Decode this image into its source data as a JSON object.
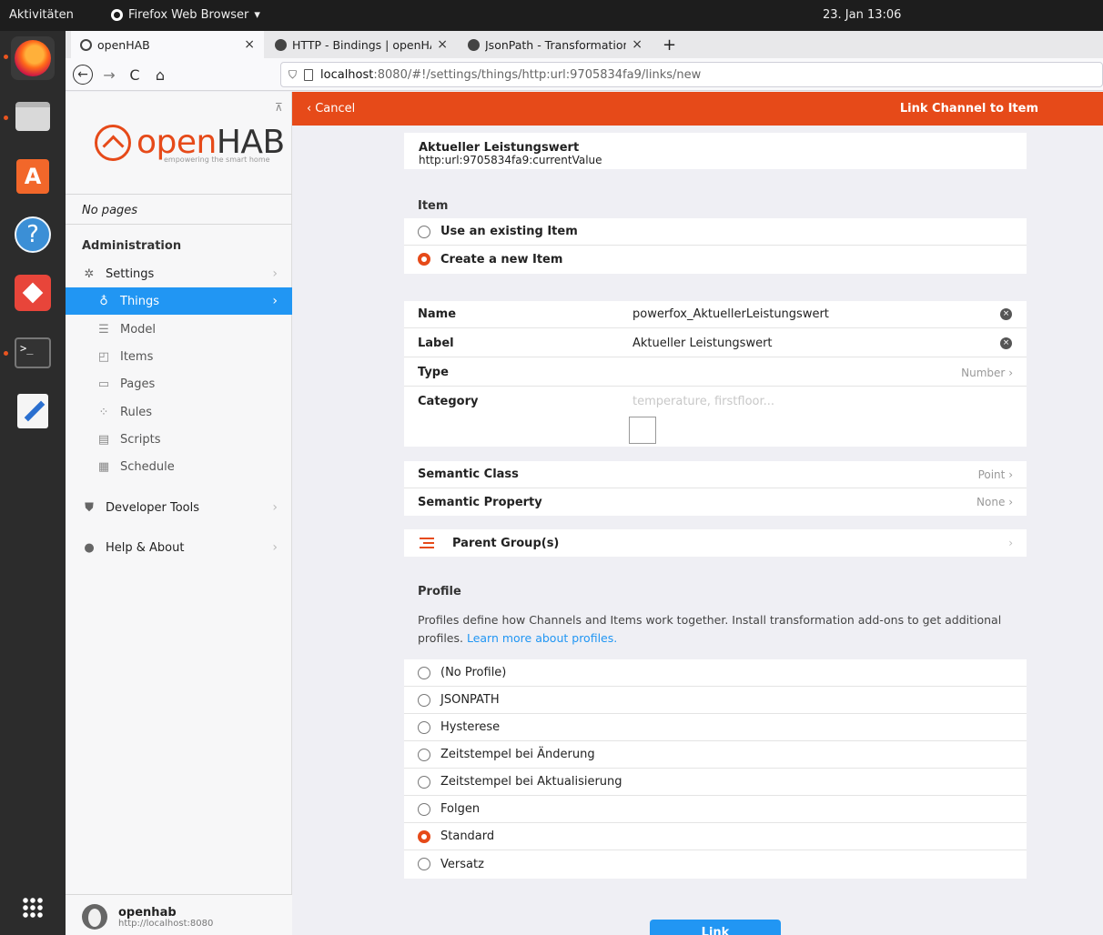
{
  "system": {
    "activities": "Aktivitäten",
    "app_menu": "Firefox Web Browser",
    "app_menu_arrow": "▾",
    "clock": "23. Jan  13:06"
  },
  "dock": {
    "items": [
      "firefox-icon",
      "files-icon",
      "software-icon",
      "help-icon",
      "anydesk-icon",
      "terminal-icon",
      "text-editor-icon",
      "app-grid-icon"
    ],
    "terminal_prompt": ">_"
  },
  "browser": {
    "tabs": [
      {
        "label": "openHAB",
        "close": "×"
      },
      {
        "label": "HTTP - Bindings | openHAB",
        "close": "×"
      },
      {
        "label": "JsonPath - Transformations",
        "close": "×"
      }
    ],
    "new_tab": "+",
    "nav": {
      "back": "←",
      "forward": "→",
      "reload": "C",
      "home": "⌂"
    },
    "url_host": "localhost",
    "url_path": ":8080/#!/settings/things/http:url:9705834fa9/links/new"
  },
  "sidebar": {
    "logo_text_1": "open",
    "logo_text_2": "HAB",
    "tagline": "empowering the smart home",
    "no_pages": "No pages",
    "admin_title": "Administration",
    "settings": "Settings",
    "sub_items": [
      "Things",
      "Model",
      "Items",
      "Pages",
      "Rules",
      "Scripts",
      "Schedule"
    ],
    "developer_tools": "Developer Tools",
    "help_about": "Help & About",
    "chevron": "›",
    "footer_user": "openhab",
    "footer_host": "http://localhost:8080"
  },
  "header": {
    "cancel": "Cancel",
    "cancel_chevron": "‹",
    "title": "Link Channel to Item"
  },
  "channel": {
    "title": "Aktueller Leistungswert",
    "uid": "http:url:9705834fa9:currentValue"
  },
  "item_section": {
    "title": "Item",
    "options": [
      "Use an existing Item",
      "Create a new Item"
    ],
    "selected": 1
  },
  "form": {
    "name_label": "Name",
    "name_value": "powerfox_AktuellerLeistungswert",
    "label_label": "Label",
    "label_value": "Aktueller Leistungswert",
    "type_label": "Type",
    "type_value": "Number",
    "category_label": "Category",
    "category_placeholder": "temperature, firstfloor...",
    "clear": "×",
    "chevron": "›"
  },
  "semantic": {
    "class_label": "Semantic Class",
    "class_value": "Point",
    "property_label": "Semantic Property",
    "property_value": "None"
  },
  "parent_groups": {
    "label": "Parent Group(s)"
  },
  "profile": {
    "title": "Profile",
    "description": "Profiles define how Channels and Items work together. Install transformation add-ons to get additional profiles. ",
    "learn_more": "Learn more about profiles.",
    "options": [
      "(No Profile)",
      "JSONPATH",
      "Hysterese",
      "Zeitstempel bei Änderung",
      "Zeitstempel bei Aktualisierung",
      "Folgen",
      "Standard",
      "Versatz"
    ],
    "selected": 6
  },
  "actions": {
    "link": "Link"
  },
  "colors": {
    "accent": "#e64a19",
    "primary": "#2196f3"
  }
}
